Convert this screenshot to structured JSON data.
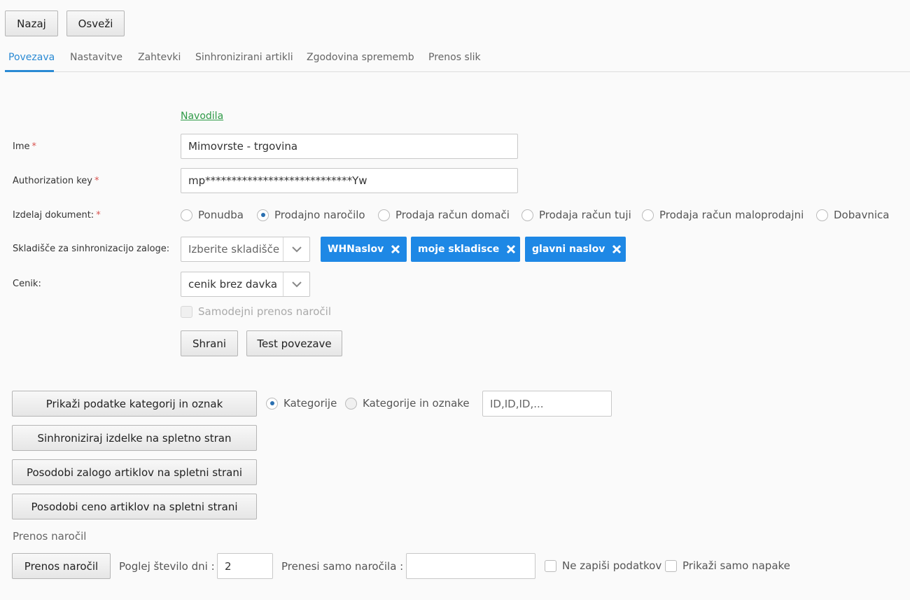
{
  "toolbar": {
    "back_label": "Nazaj",
    "refresh_label": "Osveži"
  },
  "tabs": [
    {
      "label": "Povezava",
      "active": true
    },
    {
      "label": "Nastavitve"
    },
    {
      "label": "Zahtevki"
    },
    {
      "label": "Sinhronizirani artikli"
    },
    {
      "label": "Zgodovina sprememb"
    },
    {
      "label": "Prenos slik"
    }
  ],
  "form": {
    "help_link": "Navodila",
    "name": {
      "label": "Ime",
      "required_mark": "*",
      "value": "Mimovrste - trgovina"
    },
    "auth_key": {
      "label": "Authorization key",
      "required_mark": "*",
      "value": "mp****************************Yw"
    },
    "document": {
      "label": "Izdelaj dokument:",
      "required_mark": "*",
      "options": [
        "Ponudba",
        "Prodajno naročilo",
        "Prodaja račun domači",
        "Prodaja račun tuji",
        "Prodaja račun maloprodajni",
        "Dobavnica"
      ],
      "selected": "Prodajno naročilo"
    },
    "warehouse": {
      "label": "Skladišče za sinhronizacijo zaloge:",
      "placeholder": "Izberite skladišče",
      "tags": [
        "WHNaslov",
        "moje skladisce",
        "glavni naslov"
      ]
    },
    "pricelist": {
      "label": "Cenik:",
      "value": "cenik brez davka"
    },
    "auto_transfer_label": "Samodejni prenos naročil",
    "save_label": "Shrani",
    "test_label": "Test povezave"
  },
  "sync": {
    "show_categories_label": "Prikaži podatke kategorij in oznak",
    "category_options": [
      "Kategorije",
      "Kategorije in oznake"
    ],
    "category_selected": "Kategorije",
    "ids_placeholder": "ID,ID,ID,...",
    "sync_products_label": "Sinhroniziraj izdelke na spletno stran",
    "update_stock_label": "Posodobi zalogo artiklov na spletni strani",
    "update_price_label": "Posodobi ceno artiklov na spletni strani"
  },
  "orders": {
    "section_title": "Prenos naročil",
    "transfer_label": "Prenos naročil",
    "days_label": "Poglej število dni :",
    "days_value": "2",
    "only_orders_label": "Prenesi samo naročila :",
    "only_orders_value": "",
    "no_write_label": "Ne zapiši podatkov",
    "errors_only_label": "Prikaži samo napake"
  },
  "colors": {
    "accent": "#2a8ad4",
    "tag": "#1e88e5",
    "link": "#2e9a47",
    "required": "#d9534f"
  }
}
